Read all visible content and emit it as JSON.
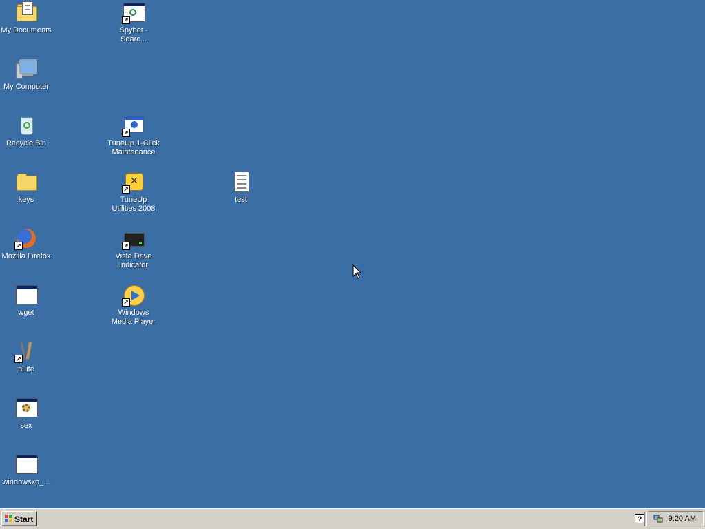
{
  "desktop": {
    "background_color": "#3a6ea5",
    "icons": [
      {
        "label": "My Documents",
        "icon": "my-documents-icon"
      },
      {
        "label": "My Computer",
        "icon": "my-computer-icon"
      },
      {
        "label": "Recycle Bin",
        "icon": "recycle-bin-icon"
      },
      {
        "label": "keys",
        "icon": "folder-icon"
      },
      {
        "label": "Mozilla Firefox",
        "icon": "firefox-icon"
      },
      {
        "label": "wget",
        "icon": "application-window-icon"
      },
      {
        "label": "nLite",
        "icon": "nlite-icon"
      },
      {
        "label": "sex",
        "icon": "application-gear-icon"
      },
      {
        "label": "windowsxp_...",
        "icon": "application-window-icon"
      },
      {
        "label": "Spybot - Searc...",
        "icon": "spybot-icon"
      },
      {
        "label": "TuneUp 1-Click Maintenance",
        "icon": "tuneup-1-click-icon"
      },
      {
        "label": "TuneUp Utilities 2008",
        "icon": "tuneup-utilities-icon"
      },
      {
        "label": "Vista Drive Indicator",
        "icon": "drive-indicator-icon"
      },
      {
        "label": "Windows Media Player",
        "icon": "windows-media-player-icon"
      },
      {
        "label": "test",
        "icon": "text-document-icon"
      }
    ]
  },
  "taskbar": {
    "start_label": "Start",
    "help_glyph": "?",
    "clock": "9:20 AM"
  }
}
